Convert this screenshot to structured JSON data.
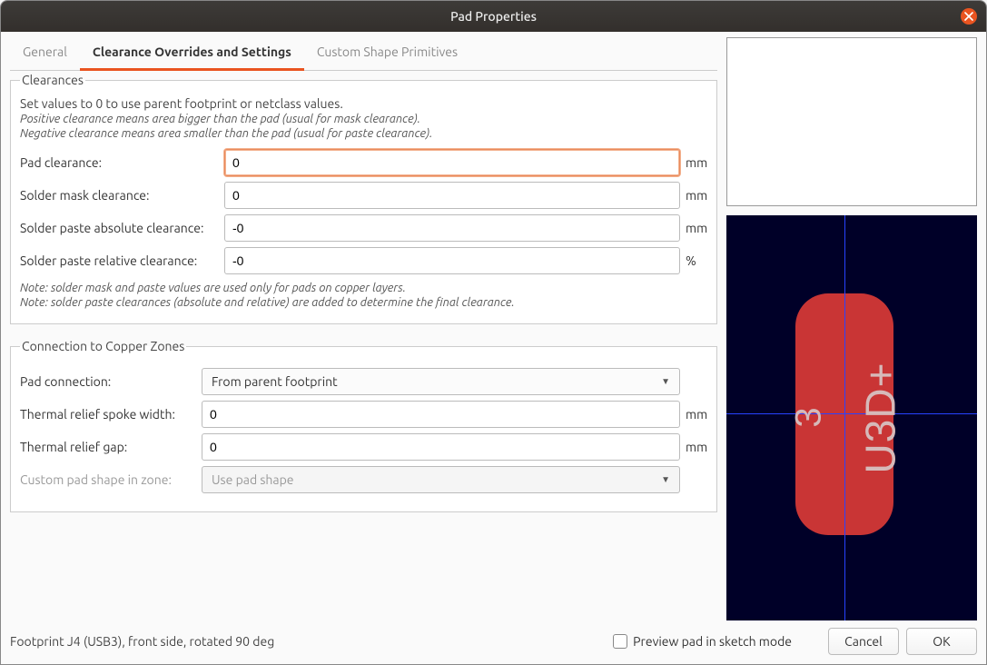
{
  "window": {
    "title": "Pad Properties"
  },
  "tabs": {
    "general": "General",
    "clearance": "Clearance Overrides and Settings",
    "custom": "Custom Shape Primitives",
    "active_index": 1
  },
  "clearances": {
    "legend": "Clearances",
    "hint_main": "Set values to 0 to use parent footprint or netclass values.",
    "hint_pos": "Positive clearance means area bigger than the pad (usual for mask clearance).",
    "hint_neg": "Negative clearance means area smaller than the pad (usual for paste clearance).",
    "pad_clearance_label": "Pad clearance:",
    "pad_clearance_value": "0",
    "pad_clearance_unit": "mm",
    "mask_clearance_label": "Solder mask clearance:",
    "mask_clearance_value": "0",
    "mask_clearance_unit": "mm",
    "paste_abs_label": "Solder paste absolute clearance:",
    "paste_abs_value": "-0",
    "paste_abs_unit": "mm",
    "paste_rel_label": "Solder paste relative clearance:",
    "paste_rel_value": "-0",
    "paste_rel_unit": "%",
    "note1": "Note: solder mask and paste values are used only for pads on copper layers.",
    "note2": "Note: solder paste clearances (absolute and relative) are added to determine the final clearance."
  },
  "copper": {
    "legend": "Connection to Copper Zones",
    "pad_connection_label": "Pad connection:",
    "pad_connection_value": "From parent footprint",
    "spoke_label": "Thermal relief spoke width:",
    "spoke_value": "0",
    "spoke_unit": "mm",
    "gap_label": "Thermal relief gap:",
    "gap_value": "0",
    "gap_unit": "mm",
    "custom_shape_label": "Custom pad shape in zone:",
    "custom_shape_value": "Use pad shape"
  },
  "preview": {
    "pad_number": "3",
    "pad_net": "U3D+"
  },
  "footer": {
    "status": "Footprint J4 (USB3), front side, rotated 90 deg",
    "sketch_checkbox": "Preview pad in sketch mode",
    "sketch_checked": false,
    "cancel": "Cancel",
    "ok": "OK"
  }
}
